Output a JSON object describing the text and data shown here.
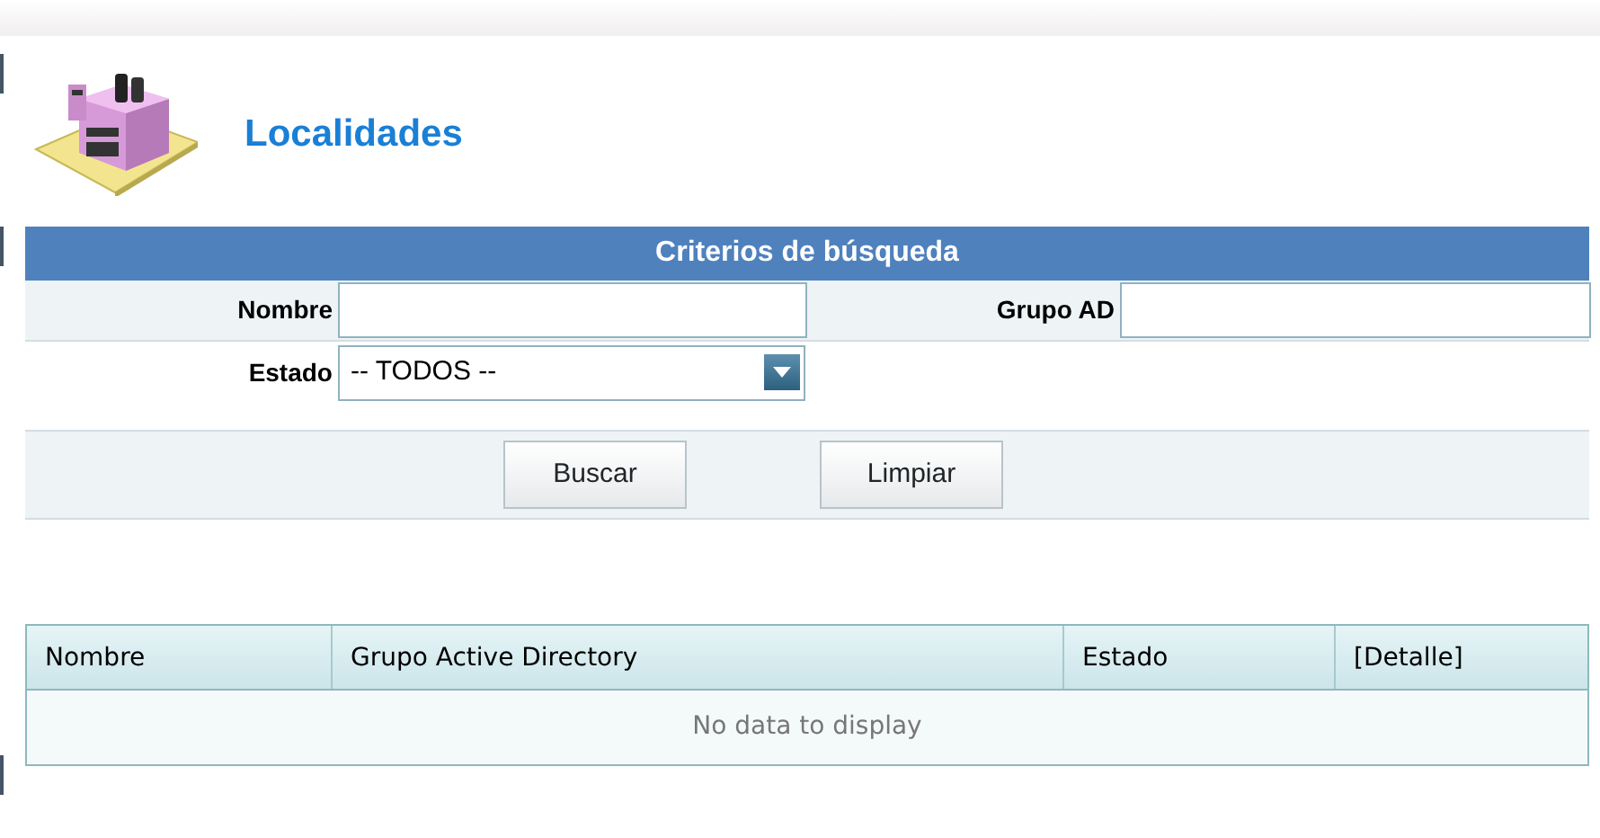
{
  "page": {
    "title": "Localidades"
  },
  "search_panel": {
    "title": "Criterios de búsqueda",
    "fields": [
      {
        "kind": "text",
        "label": "Nombre"
      },
      {
        "kind": "text",
        "label": "Grupo AD"
      },
      {
        "kind": "select",
        "label": "Estado",
        "value": "-- TODOS --"
      }
    ],
    "buttons": [
      "Buscar",
      "Limpiar"
    ]
  },
  "table": {
    "columns": [
      "Nombre",
      "Grupo Active Directory",
      "Estado",
      "[Detalle]"
    ],
    "empty_message": "No data to display"
  }
}
